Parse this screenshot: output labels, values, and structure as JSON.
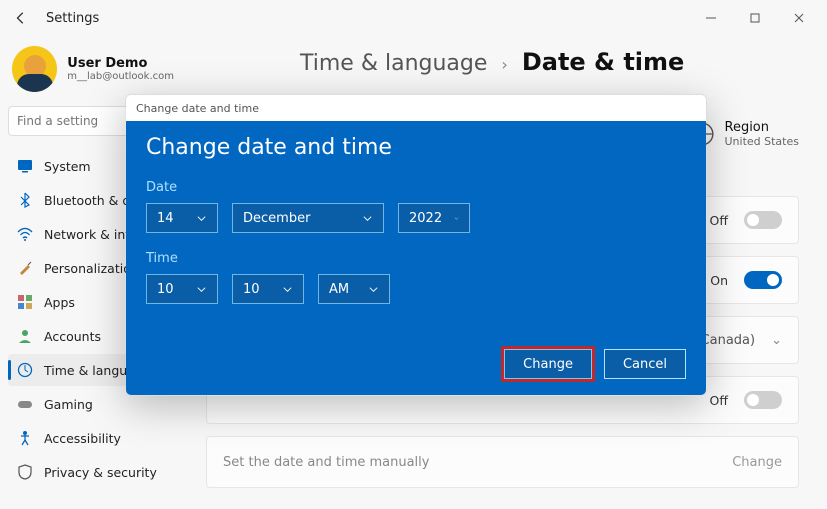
{
  "app": {
    "title": "Settings"
  },
  "user": {
    "name": "User Demo",
    "email": "m__lab@outlook.com"
  },
  "search": {
    "placeholder": "Find a setting"
  },
  "sidebar": {
    "items": [
      {
        "label": "System"
      },
      {
        "label": "Bluetooth & devices"
      },
      {
        "label": "Network & internet"
      },
      {
        "label": "Personalization"
      },
      {
        "label": "Apps"
      },
      {
        "label": "Accounts"
      },
      {
        "label": "Time & language"
      },
      {
        "label": "Gaming"
      },
      {
        "label": "Accessibility"
      },
      {
        "label": "Privacy & security"
      }
    ]
  },
  "breadcrumb": {
    "parent": "Time & language",
    "current": "Date & time"
  },
  "region": {
    "label": "Region",
    "value": "United States"
  },
  "rows": {
    "r0": {
      "state": "Off"
    },
    "r1": {
      "state": "On"
    },
    "r2": {
      "state": "Off"
    },
    "tz": {
      "value": "& Canada)"
    },
    "manual": {
      "label": "Set the date and time manually",
      "button": "Change"
    }
  },
  "dialog": {
    "caption": "Change date and time",
    "title": "Change date and time",
    "date_label": "Date",
    "time_label": "Time",
    "day": "14",
    "month": "December",
    "year": "2022",
    "hour": "10",
    "minute": "10",
    "ampm": "AM",
    "change": "Change",
    "cancel": "Cancel"
  }
}
